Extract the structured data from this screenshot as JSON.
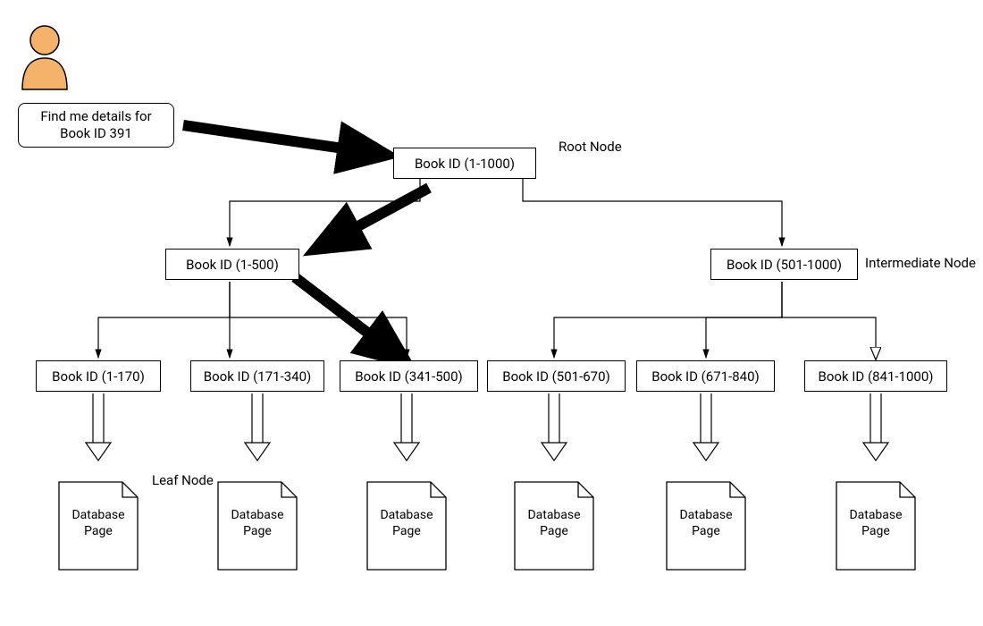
{
  "query": "Find me details for\nBook ID 391",
  "labels": {
    "root": "Root Node",
    "intermediate": "Intermediate Node",
    "leaf": "Leaf Node"
  },
  "nodes": {
    "root": "Book ID (1-1000)",
    "left": "Book ID (1-500)",
    "right": "Book ID (501-1000)",
    "leaf1": "Book ID (1-170)",
    "leaf2": "Book ID (171-340)",
    "leaf3": "Book ID (341-500)",
    "leaf4": "Book ID (501-670)",
    "leaf5": "Book ID (671-840)",
    "leaf6": "Book ID (841-1000)"
  },
  "page_label": "Database\nPage",
  "colors": {
    "user": "#f4b26a",
    "stroke": "#000"
  }
}
